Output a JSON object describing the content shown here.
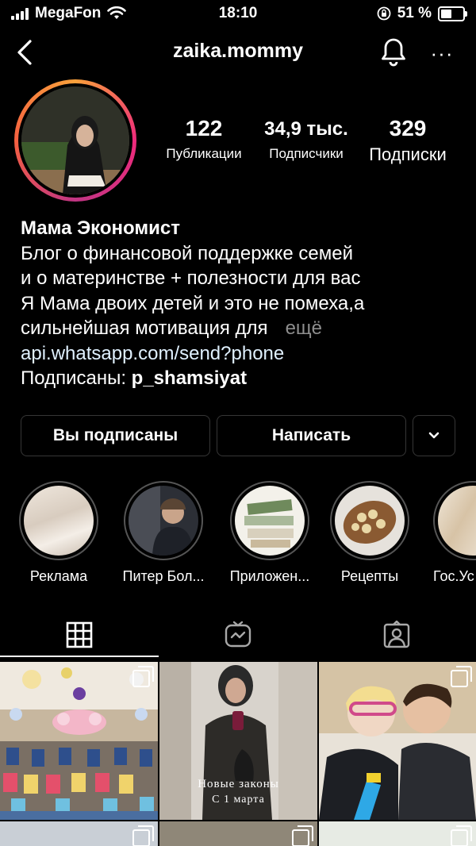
{
  "status_bar": {
    "carrier": "MegaFon",
    "time": "18:10",
    "battery": "51 %"
  },
  "header": {
    "username": "zaika.mommy",
    "more": "···"
  },
  "stats": [
    {
      "value": "122",
      "label": "Публикации"
    },
    {
      "value": "34,9 тыс.",
      "label": "Подписчики"
    },
    {
      "value": "329",
      "label": "Подписки"
    }
  ],
  "bio": {
    "name": "Мама Экономист",
    "lines": [
      "Блог о финансовой поддержке семей",
      "и о материнстве + полезности для вас",
      "Я Мама двоих детей и это не помеха,а",
      "сильнейшая мотивация для"
    ],
    "more": "ещё",
    "link": "api.whatsapp.com/send?phone",
    "followed_prefix": "Подписаны:",
    "followed_user": "p_shamsiyat"
  },
  "actions": {
    "following": "Вы подписаны",
    "message": "Написать"
  },
  "highlights": [
    {
      "label": "Реклама"
    },
    {
      "label": "Питер Бол..."
    },
    {
      "label": "Приложен..."
    },
    {
      "label": "Рецепты"
    },
    {
      "label": "Гос.Ус"
    }
  ],
  "posts": [
    {
      "caption": ""
    },
    {
      "caption_line1": "Новые законы",
      "caption_line2": "С 1 марта"
    },
    {
      "caption": ""
    }
  ],
  "colors": {
    "accent_link": "#e0f1ff",
    "muted": "#8e8e8e",
    "border": "#363636"
  }
}
